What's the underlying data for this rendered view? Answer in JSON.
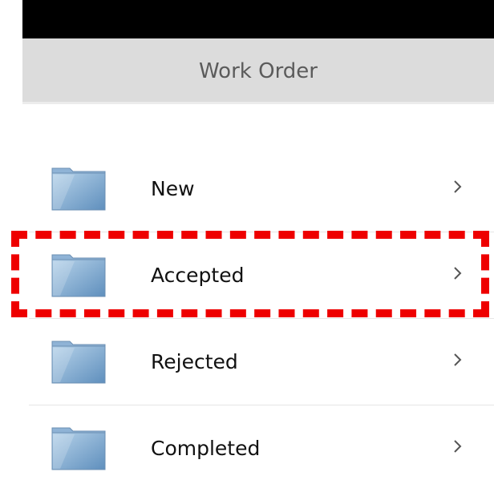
{
  "header": {
    "title": "Work Order"
  },
  "folders": [
    {
      "label": "New",
      "icon": "folder-icon"
    },
    {
      "label": "Accepted",
      "icon": "folder-icon"
    },
    {
      "label": "Rejected",
      "icon": "folder-icon"
    },
    {
      "label": "Completed",
      "icon": "folder-icon"
    }
  ],
  "highlight": {
    "target": "Accepted",
    "color": "#ee0000"
  },
  "colors": {
    "title_bar": "#dcdcdc",
    "status_bar": "#000000",
    "folder_fill": "#7fa9cf"
  }
}
